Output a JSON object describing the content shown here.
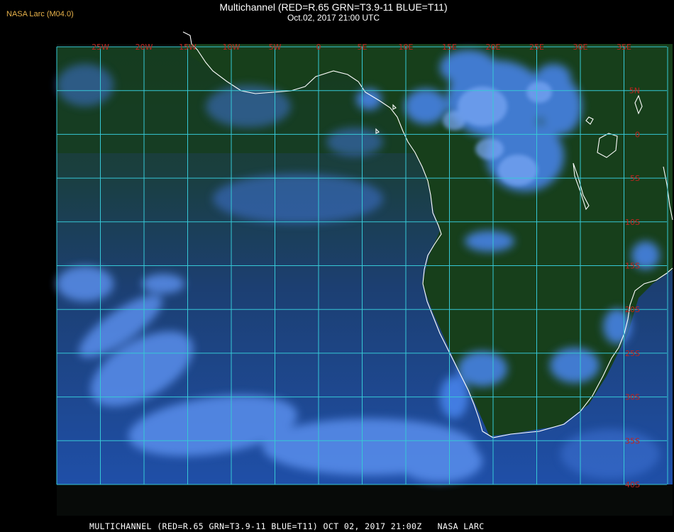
{
  "header": {
    "org_label": "NASA Larc (M04.0)",
    "title": "Multichannel (RED=R.65 GRN=T3.9-11 BLUE=T11)",
    "datetime": "Oct.02, 2017 21:00 UTC"
  },
  "map": {
    "lon_labels": [
      "25W",
      "20W",
      "15W",
      "10W",
      "5W",
      "0",
      "5E",
      "10E",
      "15E",
      "20E",
      "25E",
      "30E",
      "35E"
    ],
    "lat_labels": [
      "5N",
      "0",
      "5S",
      "10S",
      "15S",
      "20S",
      "25S",
      "30S",
      "35S",
      "40S"
    ],
    "colors": {
      "grid": "#36c8d6",
      "labels": "#c0241e",
      "coastline": "#ffffff",
      "ocean": "#1f4a8a",
      "land": "#17411d",
      "clouds": "#4a86f0"
    }
  },
  "footer": {
    "caption": "MULTICHANNEL (RED=R.65 GRN=T3.9-11 BLUE=T11) OCT 02, 2017 21:00Z   NASA LARC"
  }
}
